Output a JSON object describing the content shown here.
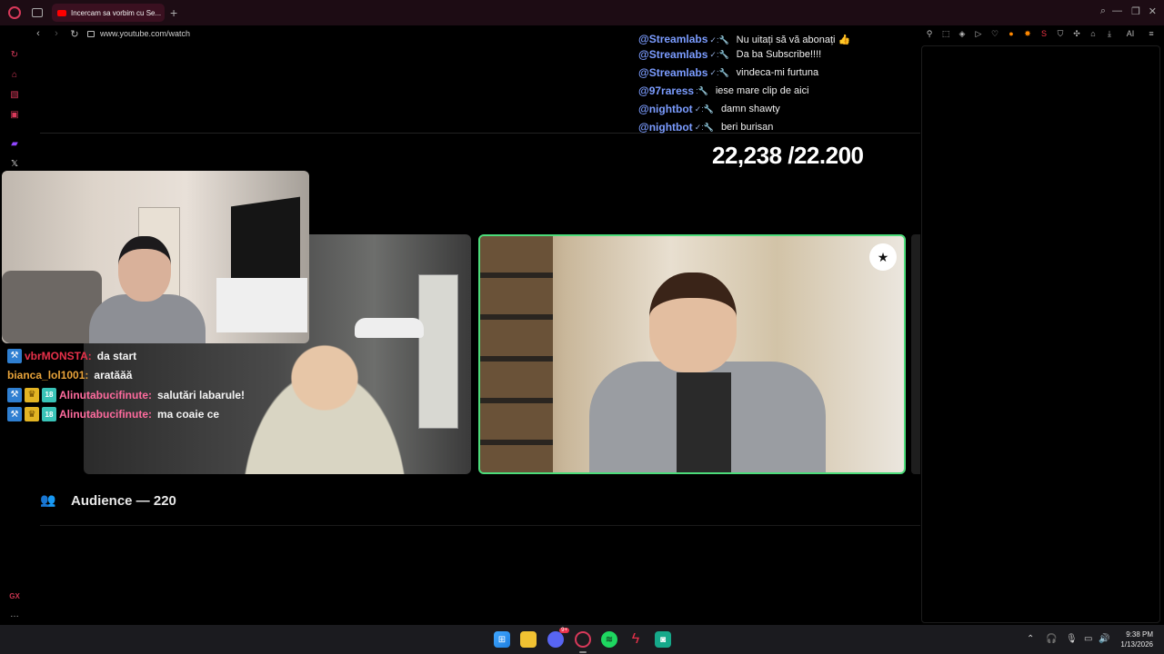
{
  "browser": {
    "tab_title": "Incercam sa vorbim cu Se...",
    "url": "www.youtube.com/watch",
    "ai_label": "AI"
  },
  "sidebar": {
    "items": [
      "history",
      "shopping",
      "pinboard",
      "music",
      "twitch",
      "x"
    ],
    "bottom": [
      "GX",
      "..."
    ]
  },
  "chat_top": [
    {
      "user": "@Streamlabs",
      "msg": "Nu uitați să vă abonați 👍"
    },
    {
      "user": "@Streamlabs",
      "msg": "Da ba Subscribe!!!!"
    },
    {
      "user": "@Streamlabs",
      "msg": "vindeca-mi furtuna"
    },
    {
      "user": "@97raress",
      "msg": "iese mare clip de aici"
    },
    {
      "user": "@nightbot",
      "msg": "damn shawty"
    },
    {
      "user": "@nightbot",
      "msg": "beri burisan"
    }
  ],
  "counter": "22,238 /22.200",
  "chat_left": [
    {
      "user": "vbrMONSTA:",
      "msg": "da start",
      "color": "#e8314a"
    },
    {
      "user": "bianca_lol1001:",
      "msg": "aratăăă",
      "color": "#e8a33a"
    },
    {
      "user": "Alinutabucifinute:",
      "msg": "salutări labarule!",
      "color": "#ff6b9e"
    },
    {
      "user": "Alinutabucifinute:",
      "msg": "ma coaie ce",
      "color": "#ff6b9e"
    }
  ],
  "audience": {
    "label": "Audience — 220"
  },
  "taskbar": {
    "discord_badge": "9+",
    "time": "9:38 PM",
    "date": "1/13/2026"
  },
  "colors": {
    "accent": "#d8395a",
    "speaking_border": "#4cdc7a",
    "chat_user": "#7b9cff"
  }
}
